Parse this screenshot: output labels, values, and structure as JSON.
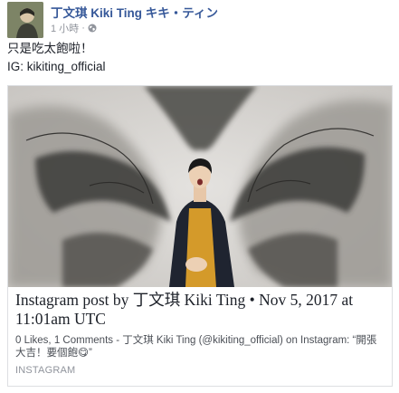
{
  "post": {
    "author": "丁文琪 Kiki Ting キキ・ティン",
    "time": "1 小時",
    "separator": "·",
    "privacy_icon": "globe-icon",
    "text_lines": [
      "只是吃太飽啦！",
      "IG: kikiting_official"
    ]
  },
  "link_preview": {
    "title": "Instagram post by 丁文琪 Kiki Ting • Nov 5, 2017 at 11:01am UTC",
    "description": "0 Likes, 1 Comments - 丁文琪 Kiki Ting (@kikiting_official) on Instagram: “開張大吉！要個飽😋”",
    "source": "INSTAGRAM"
  },
  "colors": {
    "author_link": "#365899",
    "meta_gray": "#90949c",
    "text": "#1d2129",
    "border": "#dddfe2"
  }
}
